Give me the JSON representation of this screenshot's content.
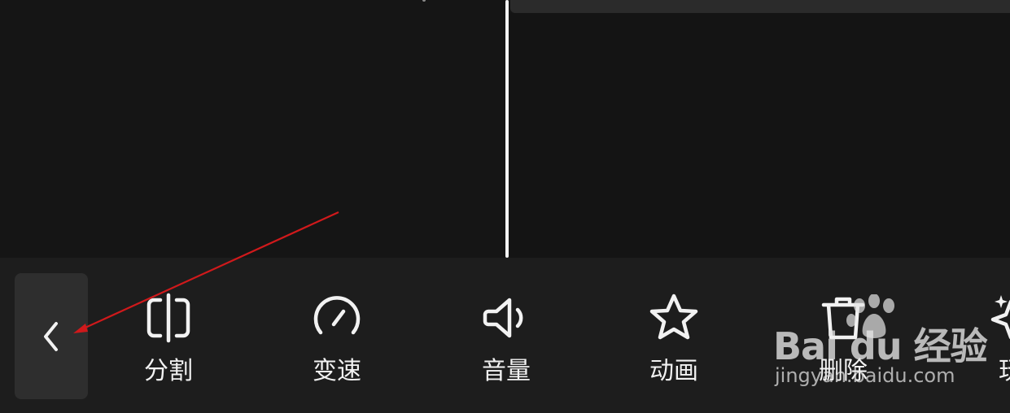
{
  "toolbar": {
    "back_icon": "chevron-left-icon",
    "tools": [
      {
        "id": "split",
        "label": "分割",
        "icon": "split-icon"
      },
      {
        "id": "speed",
        "label": "变速",
        "icon": "speedometer-icon"
      },
      {
        "id": "volume",
        "label": "音量",
        "icon": "speaker-icon"
      },
      {
        "id": "animation",
        "label": "动画",
        "icon": "star-icon"
      },
      {
        "id": "delete",
        "label": "删除",
        "icon": "trash-icon"
      },
      {
        "id": "fun",
        "label": "玩",
        "icon": "sparkle-icon"
      }
    ]
  },
  "annotation": {
    "arrow_color": "#d0191b"
  },
  "watermark": {
    "brand": "Bai du 经验",
    "url": "jingyan.baidu.com"
  },
  "colors": {
    "background": "#151515",
    "toolbar": "#1d1d1d",
    "playhead": "#f4f4f4",
    "back_button": "#2e2e2e",
    "icon": "#f2f2f2"
  }
}
